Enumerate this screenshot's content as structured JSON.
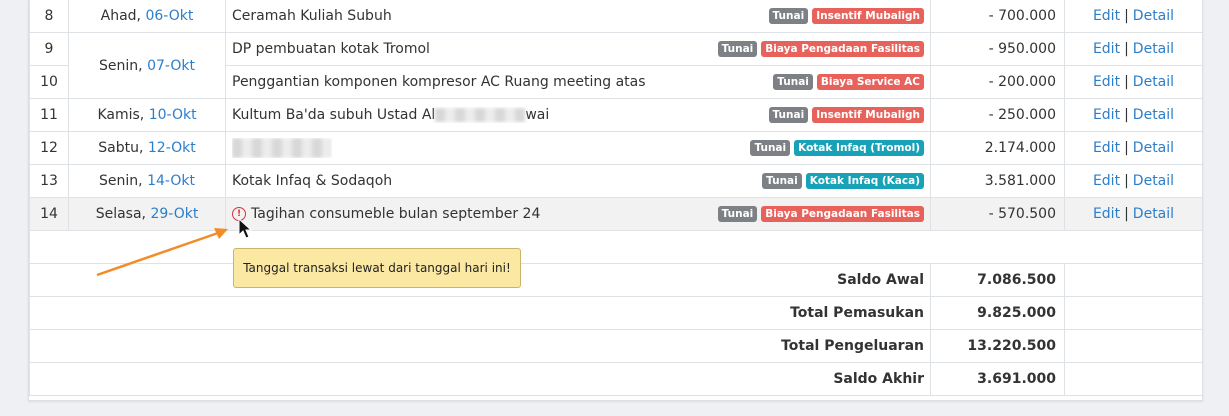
{
  "rows": [
    {
      "no": "8",
      "day": "Ahad,",
      "date": "06-Okt",
      "desc": "Ceramah Kuliah Subuh",
      "badges": [
        {
          "label": "Tunai",
          "color": "gray"
        },
        {
          "label": "Insentif Mubaligh",
          "color": "red"
        }
      ],
      "amount": "- 700.000",
      "edit": "Edit",
      "sep": "|",
      "detail": "Detail"
    },
    {
      "no": "9",
      "day": "Senin,",
      "date": "07-Okt",
      "desc": "DP pembuatan kotak Tromol",
      "badges": [
        {
          "label": "Tunai",
          "color": "gray"
        },
        {
          "label": "Biaya Pengadaan Fasilitas",
          "color": "red"
        }
      ],
      "amount": "- 950.000",
      "edit": "Edit",
      "sep": "|",
      "detail": "Detail"
    },
    {
      "no": "10",
      "day": "",
      "date": "",
      "desc": "Penggantian komponen kompresor AC Ruang meeting atas",
      "badges": [
        {
          "label": "Tunai",
          "color": "gray"
        },
        {
          "label": "Biaya Service AC",
          "color": "red"
        }
      ],
      "amount": "- 200.000",
      "edit": "Edit",
      "sep": "|",
      "detail": "Detail"
    },
    {
      "no": "11",
      "day": "Kamis,",
      "date": "10-Okt",
      "desc_pre": "Kultum Ba'da subuh Ustad Al",
      "desc_post": "wai",
      "badges": [
        {
          "label": "Tunai",
          "color": "gray"
        },
        {
          "label": "Insentif Mubaligh",
          "color": "red"
        }
      ],
      "amount": "- 250.000",
      "edit": "Edit",
      "sep": "|",
      "detail": "Detail"
    },
    {
      "no": "12",
      "day": "Sabtu,",
      "date": "12-Okt",
      "desc": "",
      "badges": [
        {
          "label": "Tunai",
          "color": "gray"
        },
        {
          "label": "Kotak Infaq (Tromol)",
          "color": "teal"
        }
      ],
      "amount": "2.174.000",
      "edit": "Edit",
      "sep": "|",
      "detail": "Detail"
    },
    {
      "no": "13",
      "day": "Senin,",
      "date": "14-Okt",
      "desc": "Kotak Infaq & Sodaqoh",
      "badges": [
        {
          "label": "Tunai",
          "color": "gray"
        },
        {
          "label": "Kotak Infaq (Kaca)",
          "color": "teal"
        }
      ],
      "amount": "3.581.000",
      "edit": "Edit",
      "sep": "|",
      "detail": "Detail"
    },
    {
      "no": "14",
      "day": "Selasa,",
      "date": "29-Okt",
      "warning": true,
      "desc": "Tagihan consumeble bulan september 24",
      "badges": [
        {
          "label": "Tunai",
          "color": "gray"
        },
        {
          "label": "Biaya Pengadaan Fasilitas",
          "color": "red"
        }
      ],
      "amount": "- 570.500",
      "edit": "Edit",
      "sep": "|",
      "detail": "Detail"
    }
  ],
  "summary": [
    {
      "label": "Saldo Awal",
      "value": "7.086.500"
    },
    {
      "label": "Total Pemasukan",
      "value": "9.825.000"
    },
    {
      "label": "Total Pengeluaran",
      "value": "13.220.500"
    },
    {
      "label": "Saldo Akhir",
      "value": "3.691.000"
    }
  ],
  "tooltip": {
    "text": "Tanggal transaksi lewat dari tanggal hari ini!"
  },
  "icons": {
    "warning": "alert-circle-icon",
    "arrow": "annotation-arrow",
    "cursor": "mouse-pointer-icon"
  },
  "colors": {
    "link": "#2d7ec9",
    "badge_gray": "#7d8185",
    "badge_red": "#e8625c",
    "badge_teal": "#17a2b8",
    "tooltip_bg": "#fbe8a3",
    "arrow": "#f28c28",
    "warning": "#d9333a"
  }
}
